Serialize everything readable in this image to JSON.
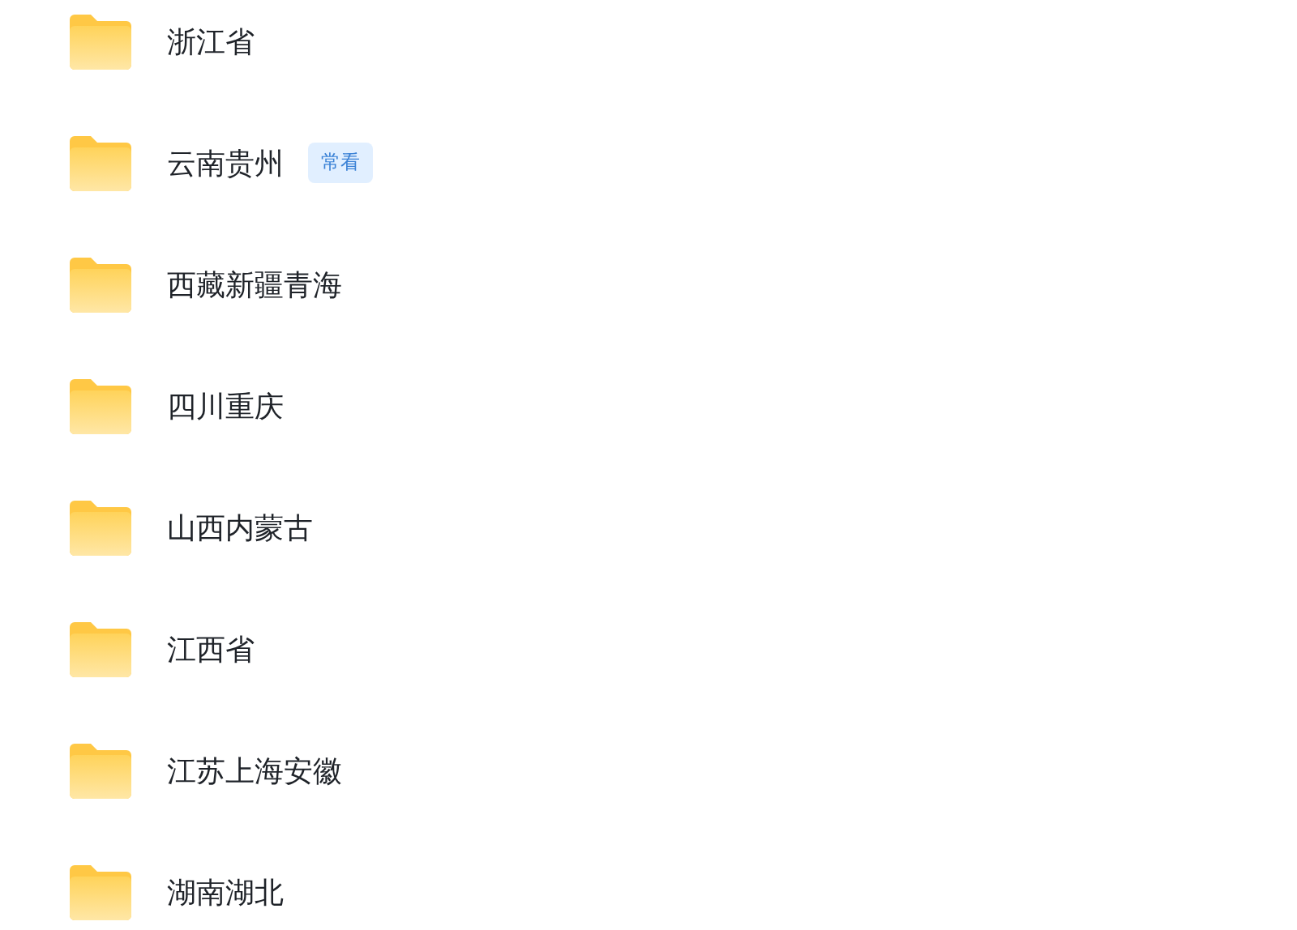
{
  "folders": [
    {
      "name": "浙江省"
    },
    {
      "name": "云南贵州",
      "badge": "常看"
    },
    {
      "name": "西藏新疆青海"
    },
    {
      "name": "四川重庆"
    },
    {
      "name": "山西内蒙古"
    },
    {
      "name": "江西省"
    },
    {
      "name": "江苏上海安徽"
    },
    {
      "name": "湖南湖北"
    }
  ]
}
